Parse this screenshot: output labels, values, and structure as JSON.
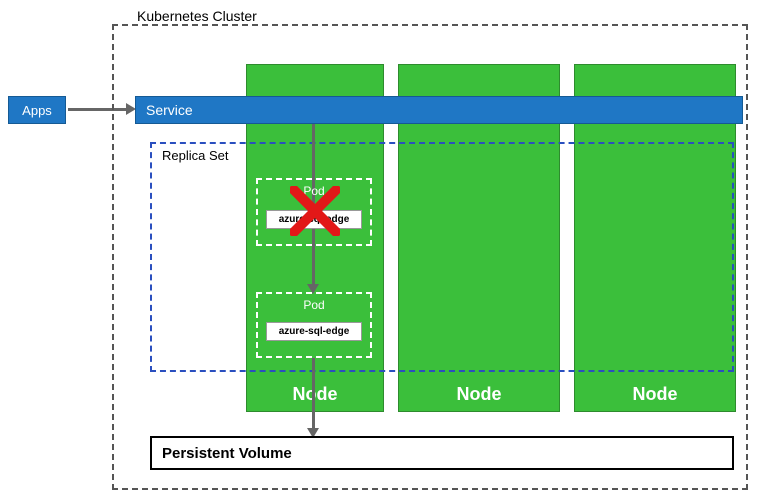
{
  "apps": {
    "label": "Apps"
  },
  "cluster": {
    "label": "Kubernetes Cluster"
  },
  "service": {
    "label": "Service"
  },
  "replicaSet": {
    "label": "Replica Set"
  },
  "nodes": [
    {
      "label": "Node"
    },
    {
      "label": "Node"
    },
    {
      "label": "Node"
    }
  ],
  "pods": [
    {
      "label": "Pod",
      "container": "azure-sql-edge",
      "failed": true
    },
    {
      "label": "Pod",
      "container": "azure-sql-edge",
      "failed": false
    }
  ],
  "persistentVolume": {
    "label": "Persistent Volume"
  },
  "colors": {
    "node": "#3bbf3b",
    "service": "#1f77c5",
    "replicaBorder": "#2a4fbf"
  }
}
